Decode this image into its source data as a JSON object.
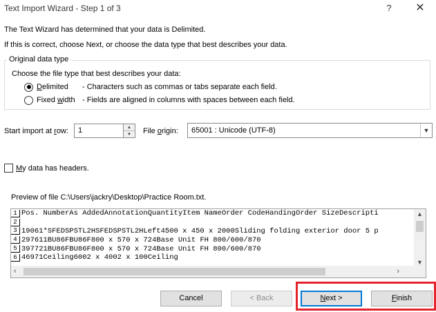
{
  "window": {
    "title": "Text Import Wizard - Step 1 of 3",
    "help_glyph": "?",
    "close_glyph": "✕"
  },
  "intro": {
    "line1": "The Text Wizard has determined that your data is Delimited.",
    "line2": "If this is correct, choose Next, or choose the data type that best describes your data."
  },
  "data_type": {
    "group_label": "Original data type",
    "prompt": "Choose the file type that best describes your data:",
    "options": [
      {
        "key": "D",
        "label_rest": "elimited",
        "description": "- Characters such as commas or tabs separate each field.",
        "selected": true
      },
      {
        "key": "w",
        "label_pre": "Fixed ",
        "label_rest": "idth",
        "description": "- Fields are aligned in columns with spaces between each field.",
        "selected": false
      }
    ]
  },
  "import_settings": {
    "start_row_label_pre": "Start import at ",
    "start_row_key": "r",
    "start_row_label_post": "ow:",
    "start_row_value": "1",
    "origin_label_pre": "File ",
    "origin_key": "o",
    "origin_label_post": "rigin:",
    "origin_value": "65001 : Unicode (UTF-8)"
  },
  "headers_checkbox": {
    "key": "M",
    "label_rest": "y data has headers.",
    "checked": false
  },
  "preview": {
    "label": "Preview of file C:\\Users\\jackry\\Desktop\\Practice Room.txt.",
    "rows": [
      {
        "num": "1",
        "text": "Pos. NumberAs AddedAnnotationQuantityItem NameOrder CodeHandingOrder SizeDescripti"
      },
      {
        "num": "2",
        "text": ""
      },
      {
        "num": "3",
        "text": "19061*SFEDSPSTL2HSFEDSPSTL2HLeft4500 x 450 x 2000Sliding folding exterior door 5 p"
      },
      {
        "num": "4",
        "text": "297611BU86FBU86F800 x 570 x 724Base Unit FH 800/600/870"
      },
      {
        "num": "5",
        "text": "397721BU86FBU86F800 x 570 x 724Base Unit FH 800/600/870"
      },
      {
        "num": "6",
        "text": "46971Ceiling6002 x 4002 x 100Ceiling"
      }
    ]
  },
  "buttons": {
    "cancel": "Cancel",
    "back": "< Back",
    "next_key": "N",
    "next_rest": "ext >",
    "finish_key": "F",
    "finish_rest": "inish"
  },
  "colors": {
    "highlight": "#e5222b",
    "default_button_border": "#0078d7"
  }
}
